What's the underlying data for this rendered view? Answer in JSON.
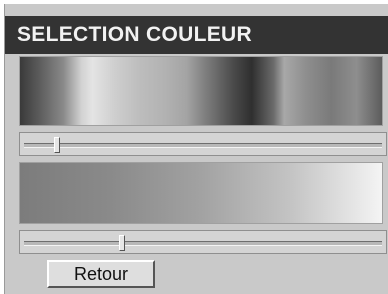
{
  "dialog": {
    "title": "SELECTION COULEUR"
  },
  "hue": {
    "slider_value": 0.09
  },
  "shade": {
    "slider_value": 0.27
  },
  "actions": {
    "back_label": "Retour"
  }
}
